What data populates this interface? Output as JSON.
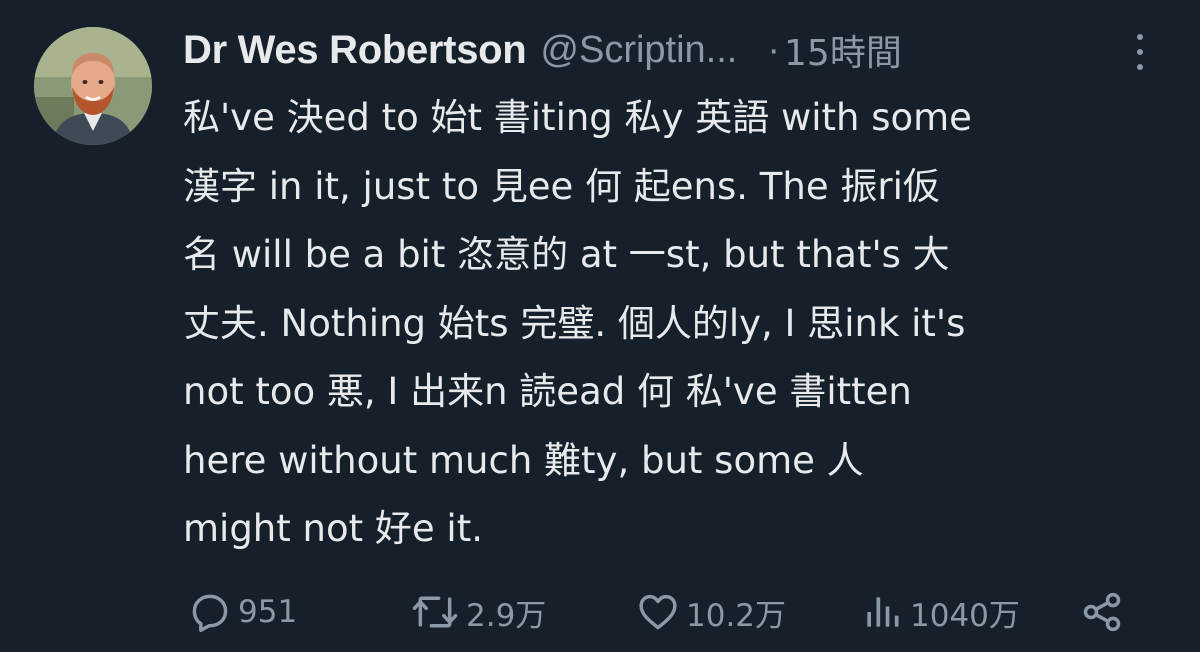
{
  "author": {
    "display_name": "Dr Wes Robertson",
    "handle": "@Scriptin...",
    "separator": "·",
    "time": "15時間",
    "avatar_icon": "profile-photo"
  },
  "tweet": {
    "lines": [
      "私've 決ed to 始t 書iting 私y 英語 with some",
      "漢字 in it, just to 見ee 何 起ens. The 振ri仮",
      "名 will be a bit 恣意的 at 一st, but that's 大",
      "丈夫. Nothing 始ts 完璧. 個人的ly, I 思ink it's",
      "not too 悪, I 出来n 読ead 何 私've 書itten",
      "here without much 難ty, but some 人",
      "might not 好e it."
    ]
  },
  "actions": {
    "reply": {
      "icon": "reply-icon",
      "count": "951"
    },
    "repost": {
      "icon": "repost-icon",
      "count": "2.9万"
    },
    "like": {
      "icon": "heart-icon",
      "count": "10.2万"
    },
    "views": {
      "icon": "views-icon",
      "count": "1040万"
    },
    "share": {
      "icon": "share-icon"
    }
  },
  "colors": {
    "background": "#15202b",
    "text": "#e7e9ea",
    "muted": "#8b98a5"
  }
}
